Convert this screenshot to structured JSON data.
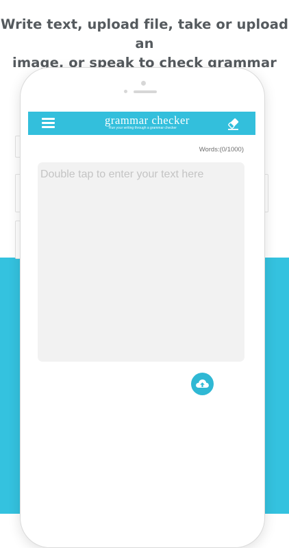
{
  "headline": {
    "line1": "Write text, upload file, take or upload an",
    "line2": "image, or speak to check grammar"
  },
  "app": {
    "title": "grammar checker",
    "tagline": "Run your writing through a grammar checker"
  },
  "editor": {
    "word_count": "Words:(0/1000)",
    "placeholder": "Double tap to enter your text here"
  },
  "icons": {
    "menu": "menu-icon",
    "eraser": "eraser-icon",
    "upload": "cloud-upload-icon"
  },
  "colors": {
    "accent": "#34c2df",
    "appbar": "#33bfdc",
    "upload_button": "#2fb8d4",
    "text_area_bg": "#f2f2f2"
  }
}
